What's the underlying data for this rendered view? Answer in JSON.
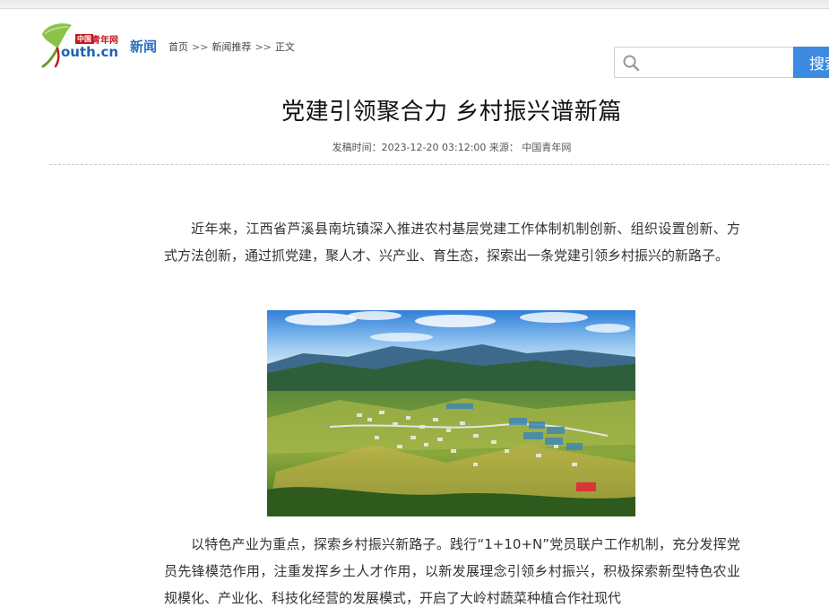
{
  "header": {
    "logo": {
      "cn_badge": "中国",
      "cn_text": "青年网",
      "en_text": "outh.cn",
      "leaf_color": "#8bc34a"
    },
    "channel": "新闻",
    "breadcrumb": {
      "items": [
        "首页",
        "新闻推荐",
        "正文"
      ],
      "separator": ">>"
    }
  },
  "search": {
    "value": "",
    "placeholder": "",
    "button_label": "搜索",
    "button_color": "#3d8be0"
  },
  "article": {
    "title": "党建引领聚合力 乡村振兴谱新篇",
    "meta": {
      "time_label": "发稿时间：",
      "time_value": "2023-12-20 03:12:00",
      "source_label": "来源：",
      "source_value": "中国青年网"
    },
    "paragraphs": [
      "近年来，江西省芦溪县南坑镇深入推进农村基层党建工作体制机制创新、组织设置创新、方式方法创新，通过抓党建，聚人才、兴产业、育生态，探索出一条党建引领乡村振兴的新路子。",
      "以特色产业为重点，探索乡村振兴新路子。践行“1+10+N”党员联户工作机制，充分发挥党员先锋模范作用，注重发挥乡土人才作用，以新发展理念引领乡村振兴，积极探索新型特色农业规模化、产业化、科技化经营的发展模式，开启了大岭村蔬菜种植合作社现代"
    ],
    "photo_icon": "aerial-village-photo"
  }
}
